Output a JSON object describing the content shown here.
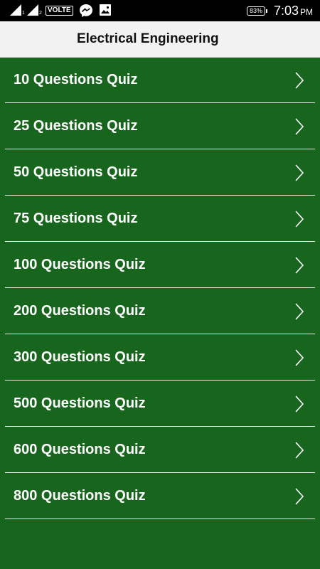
{
  "status_bar": {
    "sim1_label": "1",
    "sim2_label": "2",
    "network_badge": "VOLTE",
    "battery": "83%",
    "time": "7:03",
    "ampm": "PM",
    "icons": [
      "signal-icon",
      "signal-icon",
      "messenger-icon",
      "image-icon",
      "battery-icon"
    ]
  },
  "app_bar": {
    "title": "Electrical Engineering"
  },
  "quiz_list": {
    "items": [
      {
        "label": "10 Questions Quiz"
      },
      {
        "label": "25 Questions Quiz"
      },
      {
        "label": "50 Questions Quiz"
      },
      {
        "label": "75 Questions Quiz"
      },
      {
        "label": "100 Questions Quiz"
      },
      {
        "label": "200 Questions Quiz"
      },
      {
        "label": "300 Questions Quiz"
      },
      {
        "label": "500 Questions Quiz"
      },
      {
        "label": "600 Questions Quiz"
      },
      {
        "label": "800 Questions Quiz"
      }
    ],
    "chevron_icon": "chevron-right-icon"
  },
  "colors": {
    "background": "#18661e",
    "app_bar": "#f2f2f2",
    "status_bar": "#000000",
    "divider": "#e8efe8",
    "text_light": "#ffffff"
  }
}
